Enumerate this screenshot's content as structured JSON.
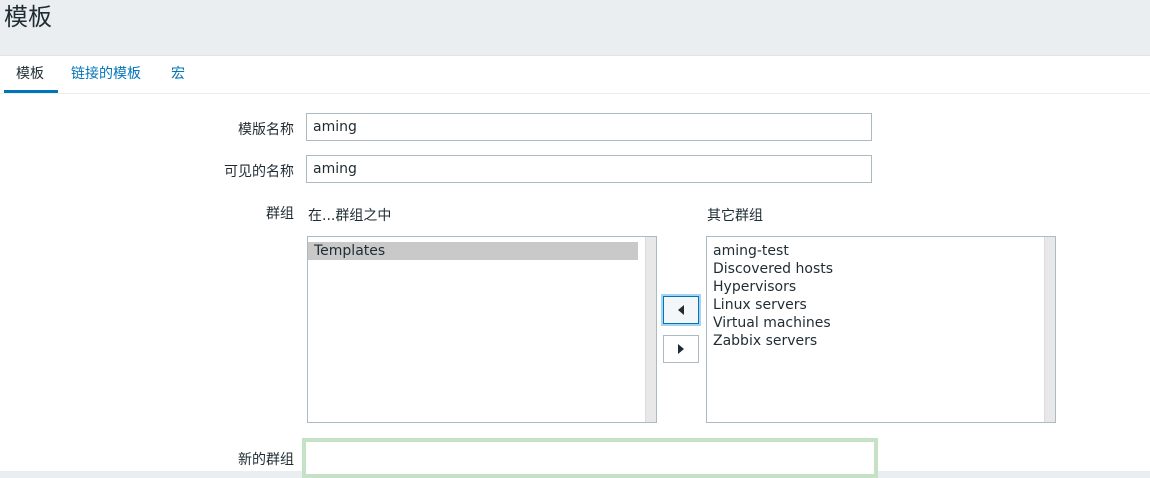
{
  "header": {
    "title": "模板"
  },
  "tabs": [
    {
      "label": "模板",
      "active": true
    },
    {
      "label": "链接的模板",
      "active": false
    },
    {
      "label": "宏",
      "active": false
    }
  ],
  "form": {
    "template_name": {
      "label": "模版名称",
      "value": "aming"
    },
    "visible_name": {
      "label": "可见的名称",
      "value": "aming"
    },
    "groups": {
      "label": "群组",
      "in_groups_label": "在...群组之中",
      "other_groups_label": "其它群组",
      "in_groups": [
        "Templates"
      ],
      "other_groups": [
        "aming-test",
        "Discovered hosts",
        "Hypervisors",
        "Linux servers",
        "Virtual machines",
        "Zabbix servers"
      ]
    },
    "new_group": {
      "label": "新的群组",
      "value": ""
    }
  },
  "colors": {
    "accent": "#0275b8",
    "selected_option": "#c9c9c9",
    "new_group_border": "#c6e2c6"
  },
  "icons": {
    "move_left": "triangle-left-icon",
    "move_right": "triangle-right-icon"
  }
}
